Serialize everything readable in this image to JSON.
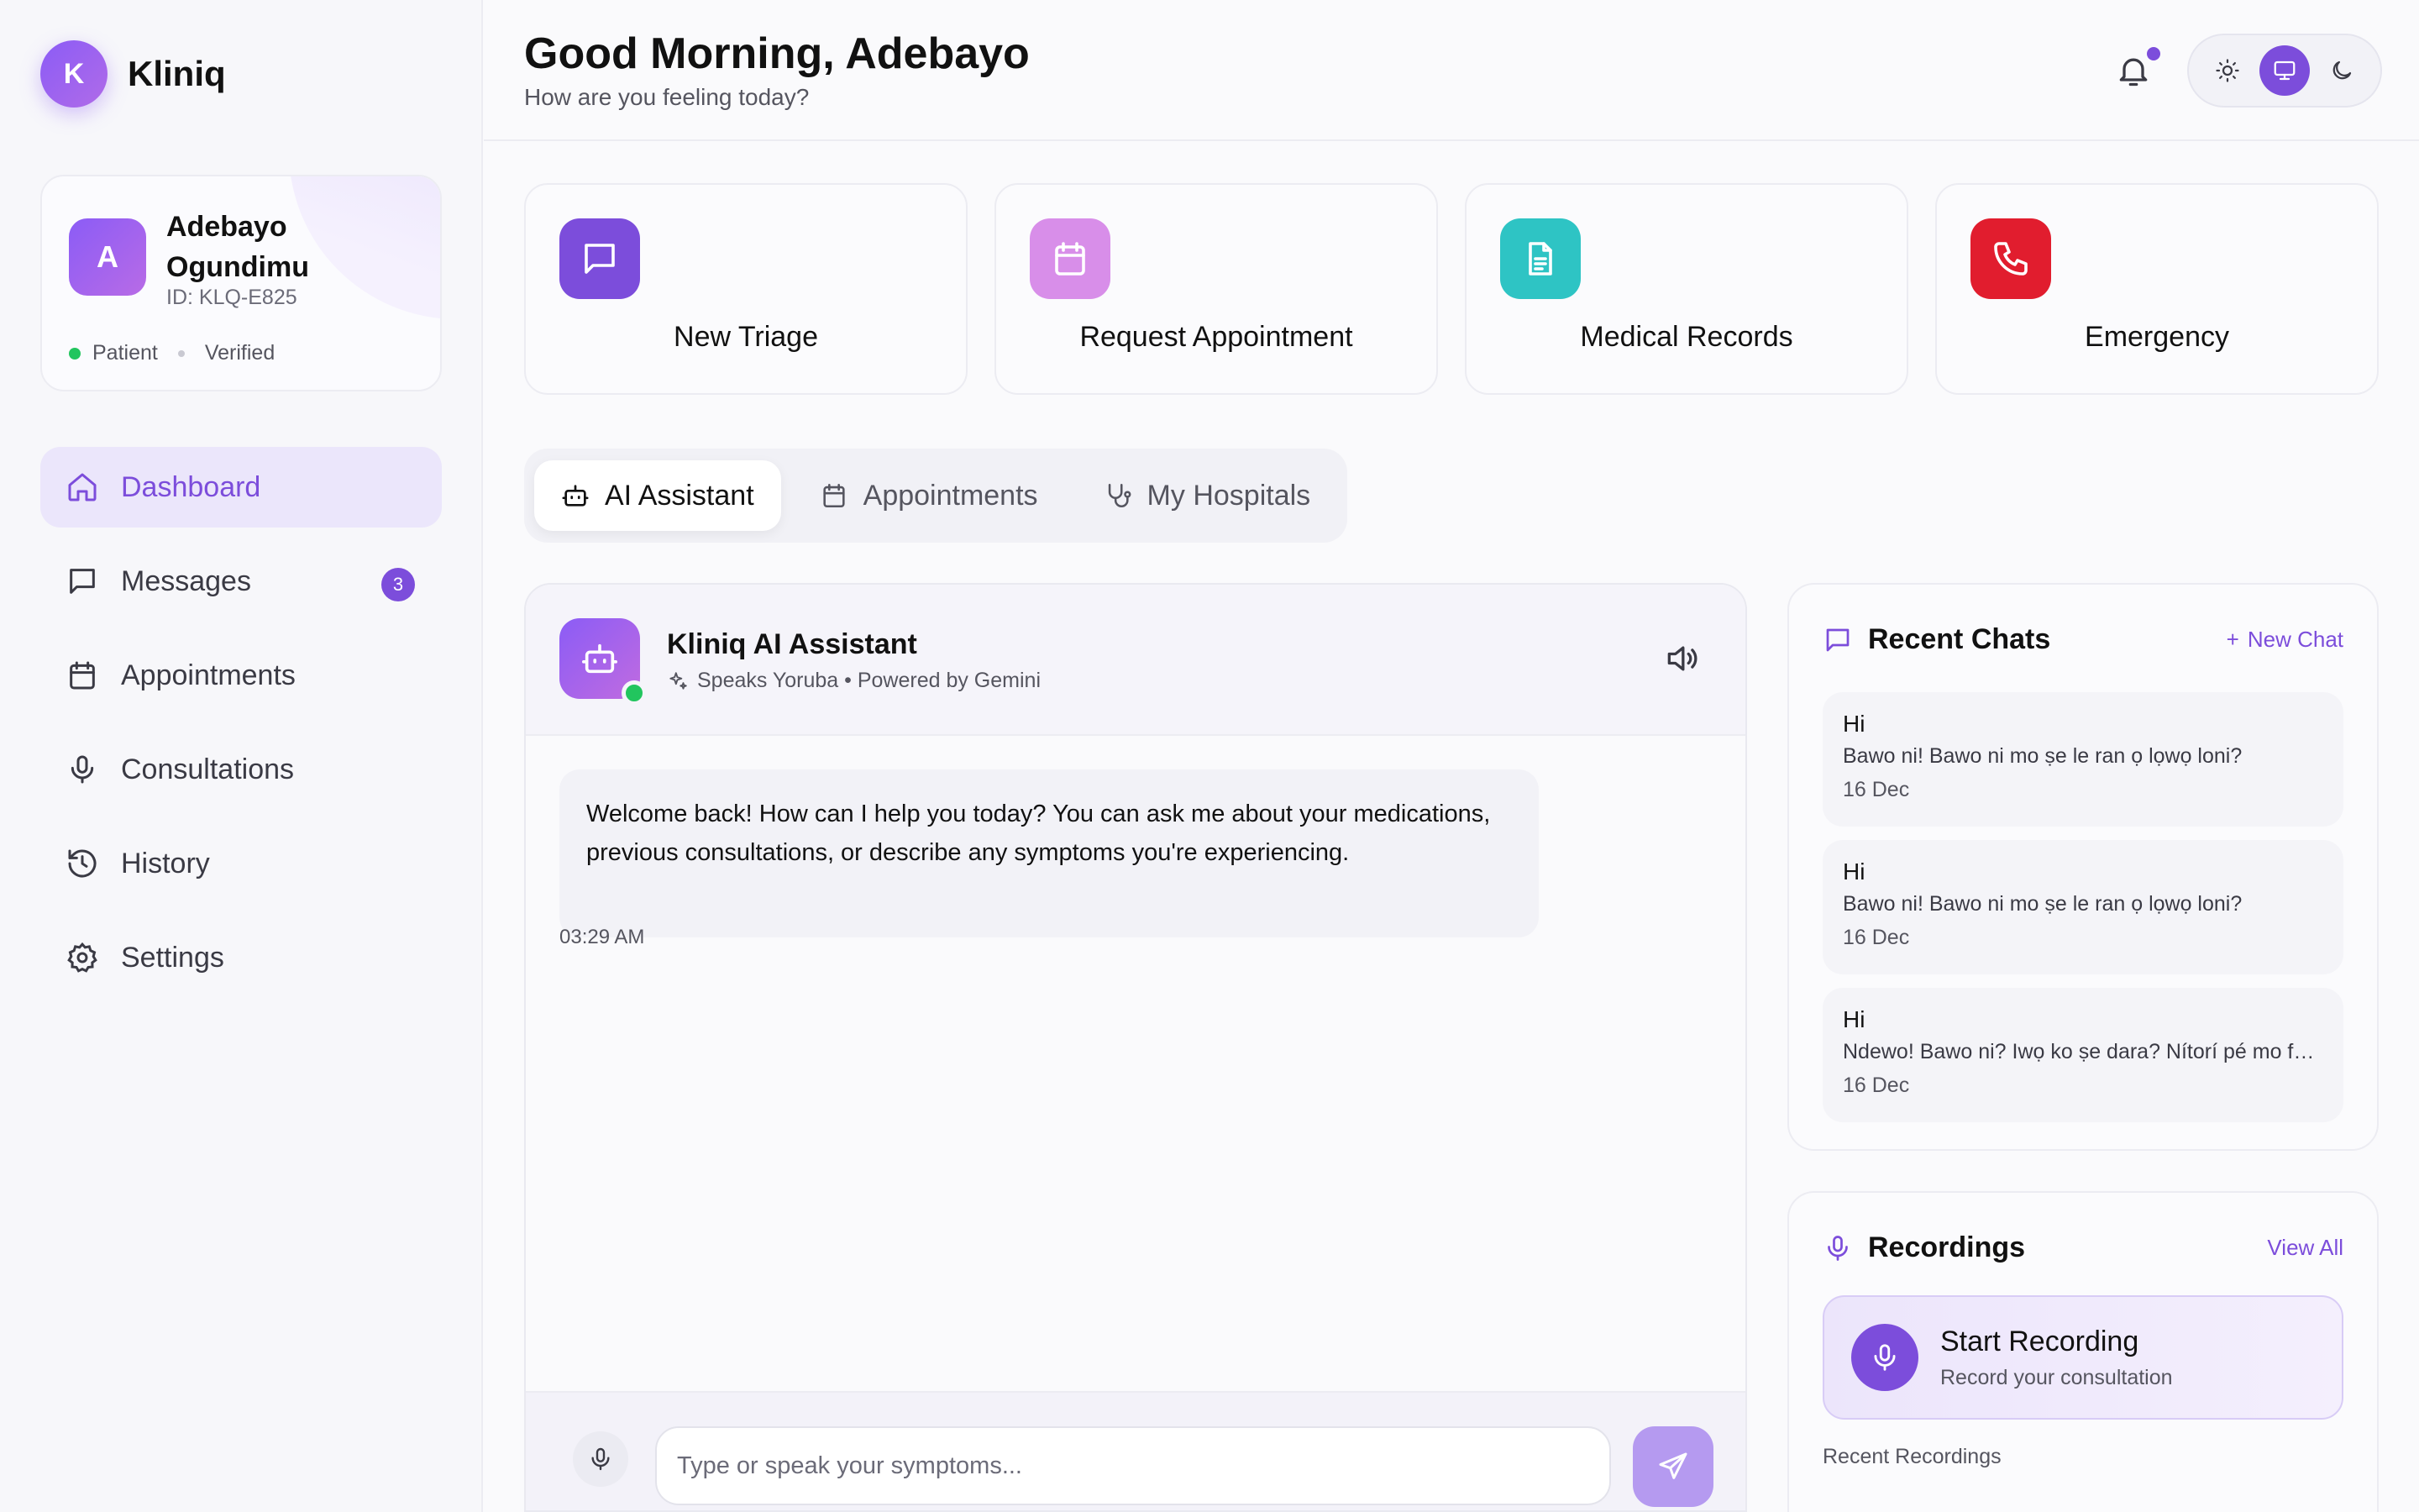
{
  "brand": {
    "logo_letter": "K",
    "name": "Kliniq"
  },
  "profile": {
    "avatar_letter": "A",
    "name": "Adebayo Ogundimu",
    "id": "ID: KLQ-E825",
    "role": "Patient",
    "status": "Verified"
  },
  "nav": {
    "items": [
      {
        "label": "Dashboard",
        "icon": "home-icon",
        "active": true
      },
      {
        "label": "Messages",
        "icon": "message-icon",
        "badge": "3"
      },
      {
        "label": "Appointments",
        "icon": "calendar-icon"
      },
      {
        "label": "Consultations",
        "icon": "mic-icon"
      },
      {
        "label": "History",
        "icon": "history-icon"
      },
      {
        "label": "Settings",
        "icon": "gear-icon"
      }
    ]
  },
  "header": {
    "greeting": "Good Morning, Adebayo",
    "subtitle": "How are you feeling today?"
  },
  "actions": [
    {
      "label": "New Triage",
      "icon": "chat-bubble-icon",
      "color": "#7c4ddb"
    },
    {
      "label": "Request Appointment",
      "icon": "calendar-icon",
      "color": "#d580e8"
    },
    {
      "label": "Medical Records",
      "icon": "document-icon",
      "color": "#2ec4c4"
    },
    {
      "label": "Emergency",
      "icon": "phone-icon",
      "color": "#e11d2e"
    }
  ],
  "tabs": [
    {
      "label": "AI Assistant",
      "icon": "bot-icon",
      "active": true
    },
    {
      "label": "Appointments",
      "icon": "calendar-icon"
    },
    {
      "label": "My Hospitals",
      "icon": "stethoscope-icon"
    }
  ],
  "assistant": {
    "name": "Kliniq AI Assistant",
    "meta": "Speaks Yoruba • Powered by Gemini",
    "message": "Welcome back! How can I help you today? You can ask me about your medications, previous consultations, or describe any symptoms you're experiencing.",
    "time": "03:29 AM",
    "input_placeholder": "Type or speak your symptoms..."
  },
  "recent_chats": {
    "title": "Recent Chats",
    "new_chat": "New Chat",
    "items": [
      {
        "title": "Hi",
        "preview": "Bawo ni! Bawo ni mo ṣe le ran ọ lọwọ loni?",
        "date": "16 Dec"
      },
      {
        "title": "Hi",
        "preview": "Bawo ni! Bawo ni mo ṣe le ran ọ lọwọ loni?",
        "date": "16 Dec"
      },
      {
        "title": "Hi",
        "preview": "Ndewo! Bawo ni? Iwọ ko ṣe dara? Nítorí pé mo fẹ́ ...",
        "date": "16 Dec"
      }
    ]
  },
  "recordings": {
    "title": "Recordings",
    "view_all": "View All",
    "start_title": "Start Recording",
    "start_sub": "Record your consultation",
    "recent_label": "Recent Recordings"
  },
  "colors": {
    "accent": "#7c4ddb",
    "online": "#22c55e"
  }
}
